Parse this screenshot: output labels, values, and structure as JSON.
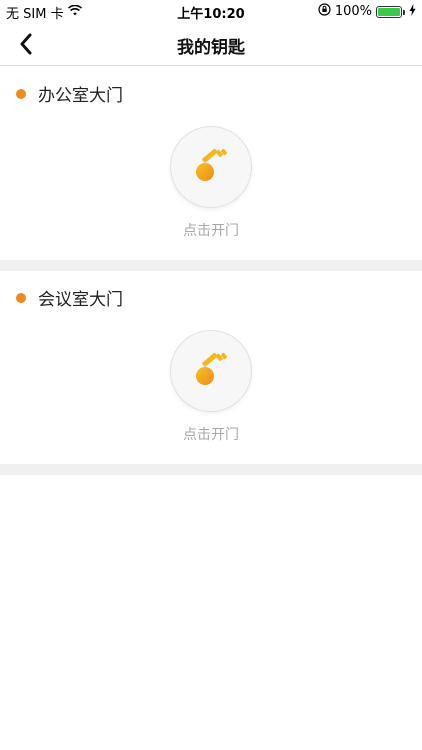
{
  "status_bar": {
    "carrier": "无 SIM 卡",
    "time": "上午10:20",
    "battery": "100%",
    "icons": [
      "wifi-icon",
      "orientation-lock-icon",
      "battery-icon",
      "charging-icon"
    ]
  },
  "nav": {
    "title": "我的钥匙",
    "back_icon": "chevron-left-icon"
  },
  "doors": [
    {
      "name": "办公室大门",
      "action_label": "点击开门"
    },
    {
      "name": "会议室大门",
      "action_label": "点击开门"
    }
  ],
  "colors": {
    "accent": "#f08a1e",
    "key_light": "#f7b51e",
    "key_dark": "#f08a1e",
    "battery": "#3cc84a",
    "divider": "#f0f0f0",
    "muted_text": "#a8a8a8"
  }
}
